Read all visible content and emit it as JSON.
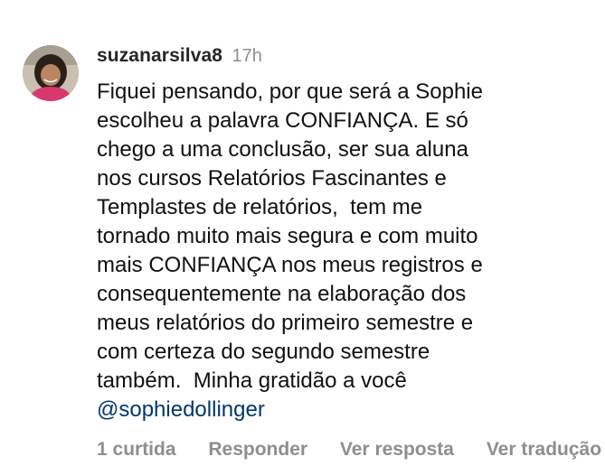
{
  "comment": {
    "username": "suzanarsilva8",
    "time": "17h",
    "lines": [
      "Fiquei pensando, por que será a Sophie",
      "escolheu a palavra CONFIANÇA. E só",
      "chego a uma conclusão, ser sua aluna",
      "nos cursos Relatórios Fascinantes e",
      "Templastes de relatórios,  tem me",
      "tornado muito mais segura e com muito",
      "mais CONFIANÇA nos meus registros e",
      "consequentemente na elaboração dos",
      "meus relatórios do primeiro semestre e",
      "com certeza do segundo semestre",
      "também.  Minha gratidão a você"
    ],
    "mention": "@sophiedollinger",
    "avatar_icon": "profile-photo"
  },
  "actions": {
    "likes": "1 curtida",
    "reply": "Responder",
    "view_reply": "Ver resposta",
    "view_translation": "Ver tradução"
  },
  "colors": {
    "text": "#111111",
    "username": "#262626",
    "muted": "#8e8e8e",
    "mention": "#00376b"
  }
}
